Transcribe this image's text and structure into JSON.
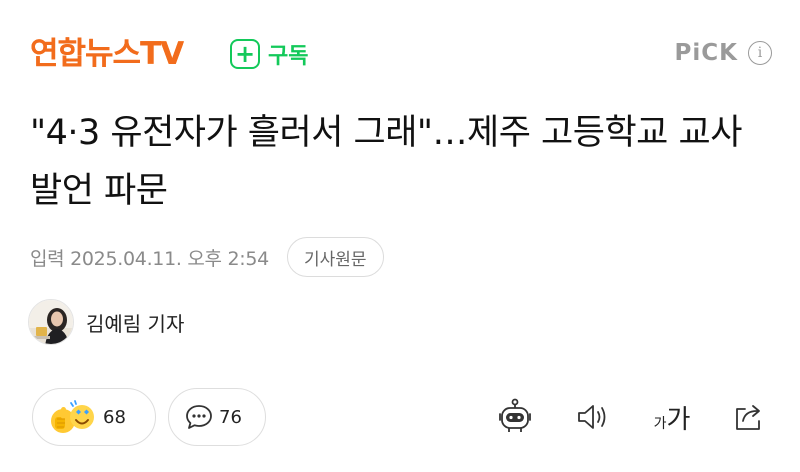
{
  "header": {
    "press_name": "연합뉴스TV",
    "subscribe_label": "구독",
    "pick_label": "PiCK",
    "info_symbol": "i"
  },
  "article": {
    "headline": "\"4·3 유전자가 흘러서 그래\"…제주 고등학교 교사 발언 파문",
    "date": "입력 2025.04.11. 오후 2:54",
    "original_button": "기사원문",
    "reporter": "김예림 기자"
  },
  "actions": {
    "reaction_count": "68",
    "comment_count": "76",
    "font_small": "가",
    "font_big": "가"
  },
  "colors": {
    "brand_orange": "#f26c1c",
    "brand_green": "#13c95a",
    "muted_gray": "#8a8a8a"
  },
  "icons": [
    "plus-icon",
    "info-icon",
    "like-emoji-icon",
    "comment-icon",
    "robot-summary-icon",
    "speaker-icon",
    "font-size-icon",
    "share-icon"
  ]
}
